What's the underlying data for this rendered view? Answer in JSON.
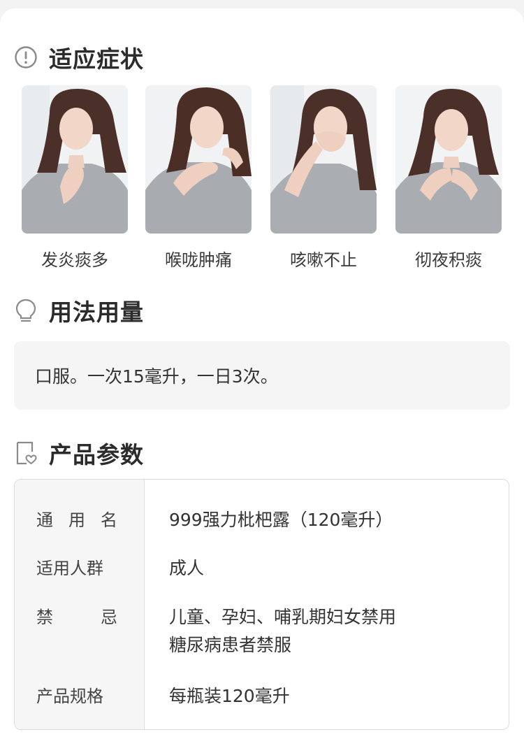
{
  "sections": {
    "symptoms_title": "适应症状",
    "usage_title": "用法用量",
    "params_title": "产品参数"
  },
  "symptoms": [
    {
      "label": "发炎痰多",
      "image": "woman-hand-on-chest-photo"
    },
    {
      "label": "喉咙肿痛",
      "image": "woman-holding-throat-photo"
    },
    {
      "label": "咳嗽不止",
      "image": "woman-covering-mouth-photo"
    },
    {
      "label": "彻夜积痰",
      "image": "woman-hands-on-chest-photo"
    }
  ],
  "usage": {
    "text": "口服。一次15毫升，一日3次。"
  },
  "params": {
    "rows": [
      {
        "key_chars": [
          "通",
          "用",
          "名"
        ],
        "value_lines": [
          "999强力枇杷露（120毫升）"
        ]
      },
      {
        "key": "适用人群",
        "value_lines": [
          "成人"
        ]
      },
      {
        "key_chars": [
          "禁",
          "忌"
        ],
        "value_lines": [
          "儿童、孕妇、哺乳期妇女禁用",
          "糖尿病患者禁服"
        ]
      },
      {
        "key": "产品规格",
        "value_lines": [
          "每瓶装120毫升"
        ]
      }
    ]
  },
  "icons": {
    "symptoms": "exclamation-circle-icon",
    "usage": "lightbulb-icon",
    "params": "document-heart-icon"
  },
  "colors": {
    "title": "#2b2b2b",
    "text": "#333333",
    "icon": "#8a8a8a",
    "box_bg": "#f5f5f5",
    "label_col_bg": "#f6f6f6",
    "border": "#dcdcdc"
  }
}
